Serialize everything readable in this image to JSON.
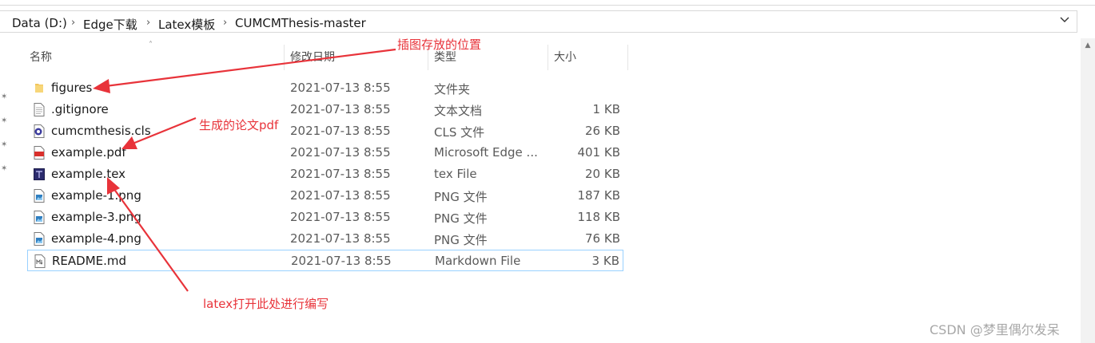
{
  "breadcrumb": {
    "items": [
      "Data (D:)",
      "Edge下载",
      "Latex模板",
      "CUMCMThesis-master"
    ]
  },
  "columns": {
    "name": "名称",
    "date": "修改日期",
    "type": "类型",
    "size": "大小"
  },
  "files": [
    {
      "name": "figures",
      "date": "2021-07-13 8:55",
      "type": "文件夹",
      "size": "",
      "icon": "folder-icon"
    },
    {
      "name": ".gitignore",
      "date": "2021-07-13 8:55",
      "type": "文本文档",
      "size": "1 KB",
      "icon": "text-file-icon"
    },
    {
      "name": "cumcmthesis.cls",
      "date": "2021-07-13 8:55",
      "type": "CLS 文件",
      "size": "26 KB",
      "icon": "cls-file-icon"
    },
    {
      "name": "example.pdf",
      "date": "2021-07-13 8:55",
      "type": "Microsoft Edge ...",
      "size": "401 KB",
      "icon": "pdf-file-icon"
    },
    {
      "name": "example.tex",
      "date": "2021-07-13 8:55",
      "type": "tex File",
      "size": "20 KB",
      "icon": "tex-file-icon"
    },
    {
      "name": "example-1.png",
      "date": "2021-07-13 8:55",
      "type": "PNG 文件",
      "size": "187 KB",
      "icon": "image-file-icon"
    },
    {
      "name": "example-3.png",
      "date": "2021-07-13 8:55",
      "type": "PNG 文件",
      "size": "118 KB",
      "icon": "image-file-icon"
    },
    {
      "name": "example-4.png",
      "date": "2021-07-13 8:55",
      "type": "PNG 文件",
      "size": "76 KB",
      "icon": "image-file-icon"
    },
    {
      "name": "README.md",
      "date": "2021-07-13 8:55",
      "type": "Markdown File",
      "size": "3 KB",
      "icon": "markdown-file-icon"
    }
  ],
  "annotations": {
    "figures": "插图存放的位置",
    "pdf": "生成的论文pdf",
    "tex": "latex打开此处进行编写"
  },
  "watermark": "CSDN @梦里偶尔发呆",
  "colors": {
    "annotation": "#e8333a",
    "selection_border": "#99d1ff",
    "folder": "#f2c55c"
  }
}
